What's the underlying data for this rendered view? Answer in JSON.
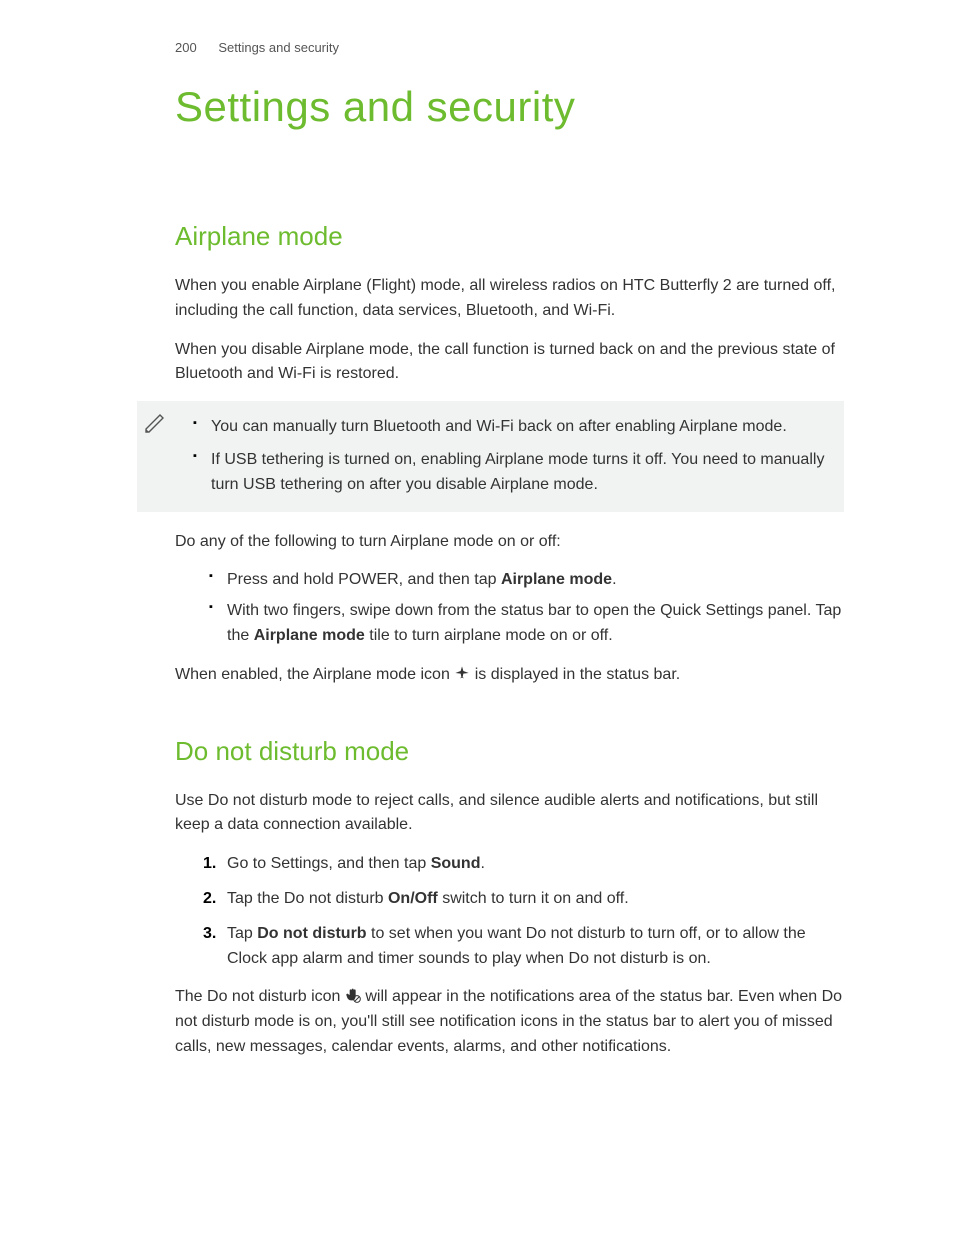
{
  "header": {
    "page_number": "200",
    "running_title": "Settings and security"
  },
  "title": "Settings and security",
  "section1": {
    "heading": "Airplane mode",
    "p1": "When you enable Airplane (Flight) mode, all wireless radios on HTC Butterfly 2 are turned off, including the call function, data services, Bluetooth, and Wi-Fi.",
    "p2": "When you disable Airplane mode, the call function is turned back on and the previous state of Bluetooth and Wi-Fi is restored.",
    "note_items": [
      "You can manually turn Bluetooth and Wi-Fi back on after enabling Airplane mode.",
      "If USB tethering is turned on, enabling Airplane mode turns it off. You need to manually turn USB tethering on after you disable Airplane mode."
    ],
    "p3": "Do any of the following to turn Airplane mode on or off:",
    "bullets": {
      "b1_pre": "Press and hold POWER, and then tap ",
      "b1_strong": "Airplane mode",
      "b1_post": ".",
      "b2_pre": "With two fingers, swipe down from the status bar to open the Quick Settings panel. Tap the ",
      "b2_strong": "Airplane mode",
      "b2_post": " tile to turn airplane mode on or off."
    },
    "p4_pre": "When enabled, the Airplane mode icon ",
    "p4_post": " is displayed in the status bar."
  },
  "section2": {
    "heading": "Do not disturb mode",
    "p1": "Use Do not disturb mode to reject calls, and silence audible alerts and notifications, but still keep a data connection available.",
    "steps": {
      "s1_pre": "Go to Settings, and then tap ",
      "s1_strong": "Sound",
      "s1_post": ".",
      "s2_pre": "Tap the Do not disturb ",
      "s2_strong": "On/Off",
      "s2_post": " switch to turn it on and off.",
      "s3_pre": "Tap ",
      "s3_strong": "Do not disturb",
      "s3_post": " to set when you want Do not disturb to turn off, or to allow the Clock app alarm and timer sounds to play when Do not disturb is on."
    },
    "p2_pre": "The Do not disturb icon ",
    "p2_post": " will appear in the notifications area of the status bar. Even when Do not disturb mode is on, you'll still see notification icons in the status bar to alert you of missed calls, new messages, calendar events, alarms, and other notifications."
  }
}
